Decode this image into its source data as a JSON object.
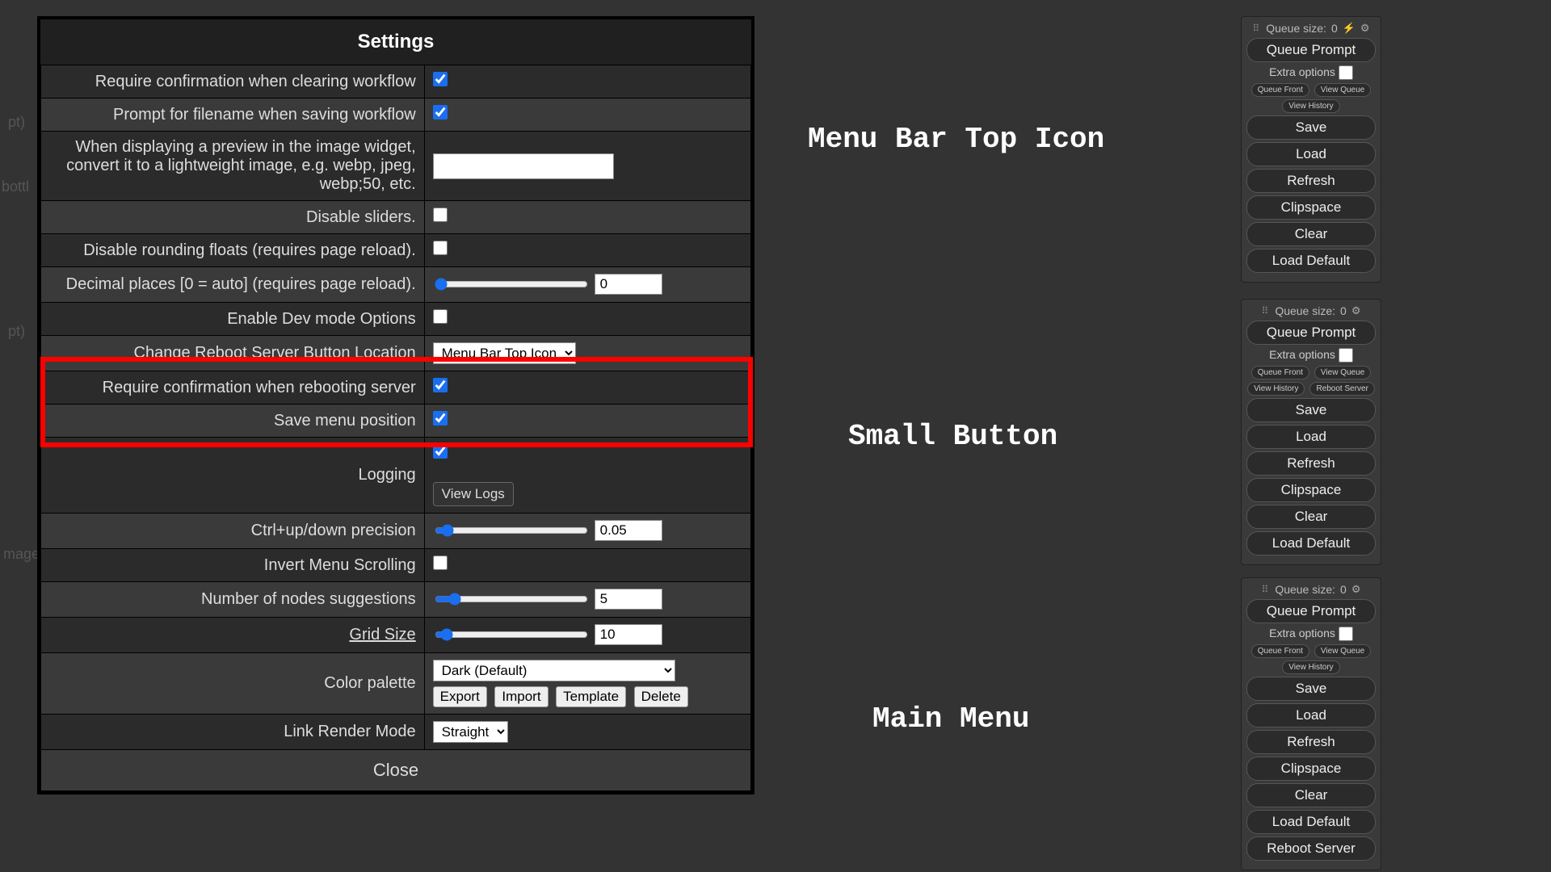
{
  "bg_labels": {
    "a": "pt)",
    "b": "bottl",
    "c": "pt)",
    "d": "mage"
  },
  "settings": {
    "title": "Settings",
    "rows": {
      "confirm_clear": {
        "label": "Require confirmation when clearing workflow",
        "checked": true
      },
      "prompt_filename": {
        "label": "Prompt for filename when saving workflow",
        "checked": true
      },
      "preview_convert": {
        "label": "When displaying a preview in the image widget, convert it to a lightweight image, e.g. webp, jpeg, webp;50, etc.",
        "value": ""
      },
      "disable_sliders": {
        "label": "Disable sliders.",
        "checked": false
      },
      "disable_rounding": {
        "label": "Disable rounding floats (requires page reload).",
        "checked": false
      },
      "decimal_places": {
        "label": "Decimal places [0 = auto] (requires page reload).",
        "value": "0"
      },
      "dev_mode": {
        "label": "Enable Dev mode Options",
        "checked": false
      },
      "reboot_location": {
        "label": "Change Reboot Server Button Location",
        "value": "Menu Bar Top Icon"
      },
      "confirm_reboot": {
        "label": "Require confirmation when rebooting server",
        "checked": true
      },
      "save_menu_pos": {
        "label": "Save menu position",
        "checked": true
      },
      "logging": {
        "label": "Logging",
        "checked": true,
        "viewlogs": "View Logs"
      },
      "ctrl_precision": {
        "label": "Ctrl+up/down precision",
        "value": "0.05"
      },
      "invert_scroll": {
        "label": "Invert Menu Scrolling",
        "checked": false
      },
      "node_suggestions": {
        "label": "Number of nodes suggestions",
        "value": "5"
      },
      "grid_size": {
        "label": "Grid Size",
        "value": "10"
      },
      "color_palette": {
        "label": "Color palette",
        "value": "Dark (Default)",
        "export": "Export",
        "import": "Import",
        "template": "Template",
        "delete": "Delete"
      },
      "link_render": {
        "label": "Link Render Mode",
        "value": "Straight"
      }
    },
    "close": "Close"
  },
  "annotations": {
    "top": "Menu Bar Top Icon",
    "mid": "Small Button",
    "bot": "Main Menu"
  },
  "menus": {
    "common": {
      "queue_prefix": "Queue size:",
      "queue_val": "0",
      "queue_prompt": "Queue Prompt",
      "extra": "Extra options",
      "queue_front": "Queue Front",
      "view_queue": "View Queue",
      "view_history": "View History",
      "reboot": "Reboot Server",
      "save": "Save",
      "load": "Load",
      "refresh": "Refresh",
      "clipspace": "Clipspace",
      "clear": "Clear",
      "load_default": "Load Default"
    }
  }
}
